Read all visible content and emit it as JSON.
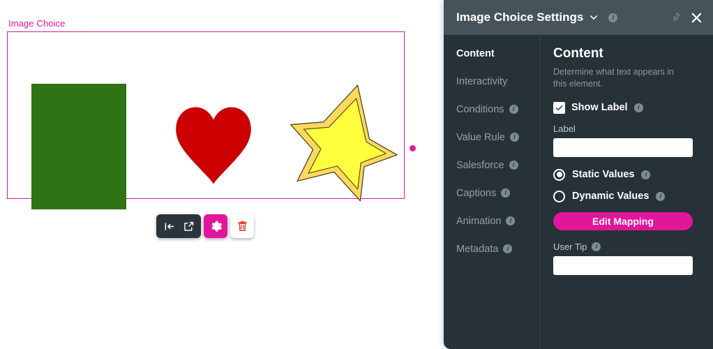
{
  "canvas": {
    "element_label": "Image Choice",
    "accent_color": "#e0169b",
    "shapes": [
      {
        "name": "rectangle",
        "color": "#2e7314"
      },
      {
        "name": "heart",
        "color": "#cc0000"
      },
      {
        "name": "star",
        "fill": "#ffff33",
        "stroke": "#e8c050"
      }
    ],
    "toolbar": {
      "items": [
        {
          "icon": "indent-left-icon",
          "label": ""
        },
        {
          "icon": "open-external-icon",
          "label": ""
        },
        {
          "icon": "gear-icon",
          "label": ""
        },
        {
          "icon": "trash-icon",
          "label": ""
        }
      ]
    }
  },
  "panel": {
    "title": "Image Choice Settings",
    "title_chevron_icon": "chevron-down-icon",
    "title_info_icon": "info-icon",
    "pin_icon": "pin-icon",
    "close_icon": "close-icon",
    "nav": {
      "items": [
        {
          "label": "Content",
          "active": true,
          "info": false
        },
        {
          "label": "Interactivity",
          "active": false,
          "info": false
        },
        {
          "label": "Conditions",
          "active": false,
          "info": true
        },
        {
          "label": "Value Rule",
          "active": false,
          "info": true
        },
        {
          "label": "Salesforce",
          "active": false,
          "info": true
        },
        {
          "label": "Captions",
          "active": false,
          "info": true
        },
        {
          "label": "Animation",
          "active": false,
          "info": true
        },
        {
          "label": "Metadata",
          "active": false,
          "info": true
        }
      ]
    },
    "content": {
      "heading": "Content",
      "description": "Determine what text appears in this element.",
      "show_label": {
        "label": "Show Label",
        "checked": true,
        "info_icon": "info-icon"
      },
      "label_field": {
        "title": "Label",
        "value": "",
        "placeholder": ""
      },
      "value_mode": {
        "static": {
          "label": "Static Values",
          "selected": true,
          "info_icon": "info-icon"
        },
        "dynamic": {
          "label": "Dynamic Values",
          "selected": false,
          "info_icon": "info-icon"
        }
      },
      "edit_mapping_label": "Edit Mapping",
      "user_tip_field": {
        "title": "User Tip",
        "value": "",
        "placeholder": "",
        "info_icon": "info-icon"
      }
    },
    "colors": {
      "header_bg": "#46535a",
      "body_bg": "#273138",
      "accent": "#e0169b"
    }
  }
}
